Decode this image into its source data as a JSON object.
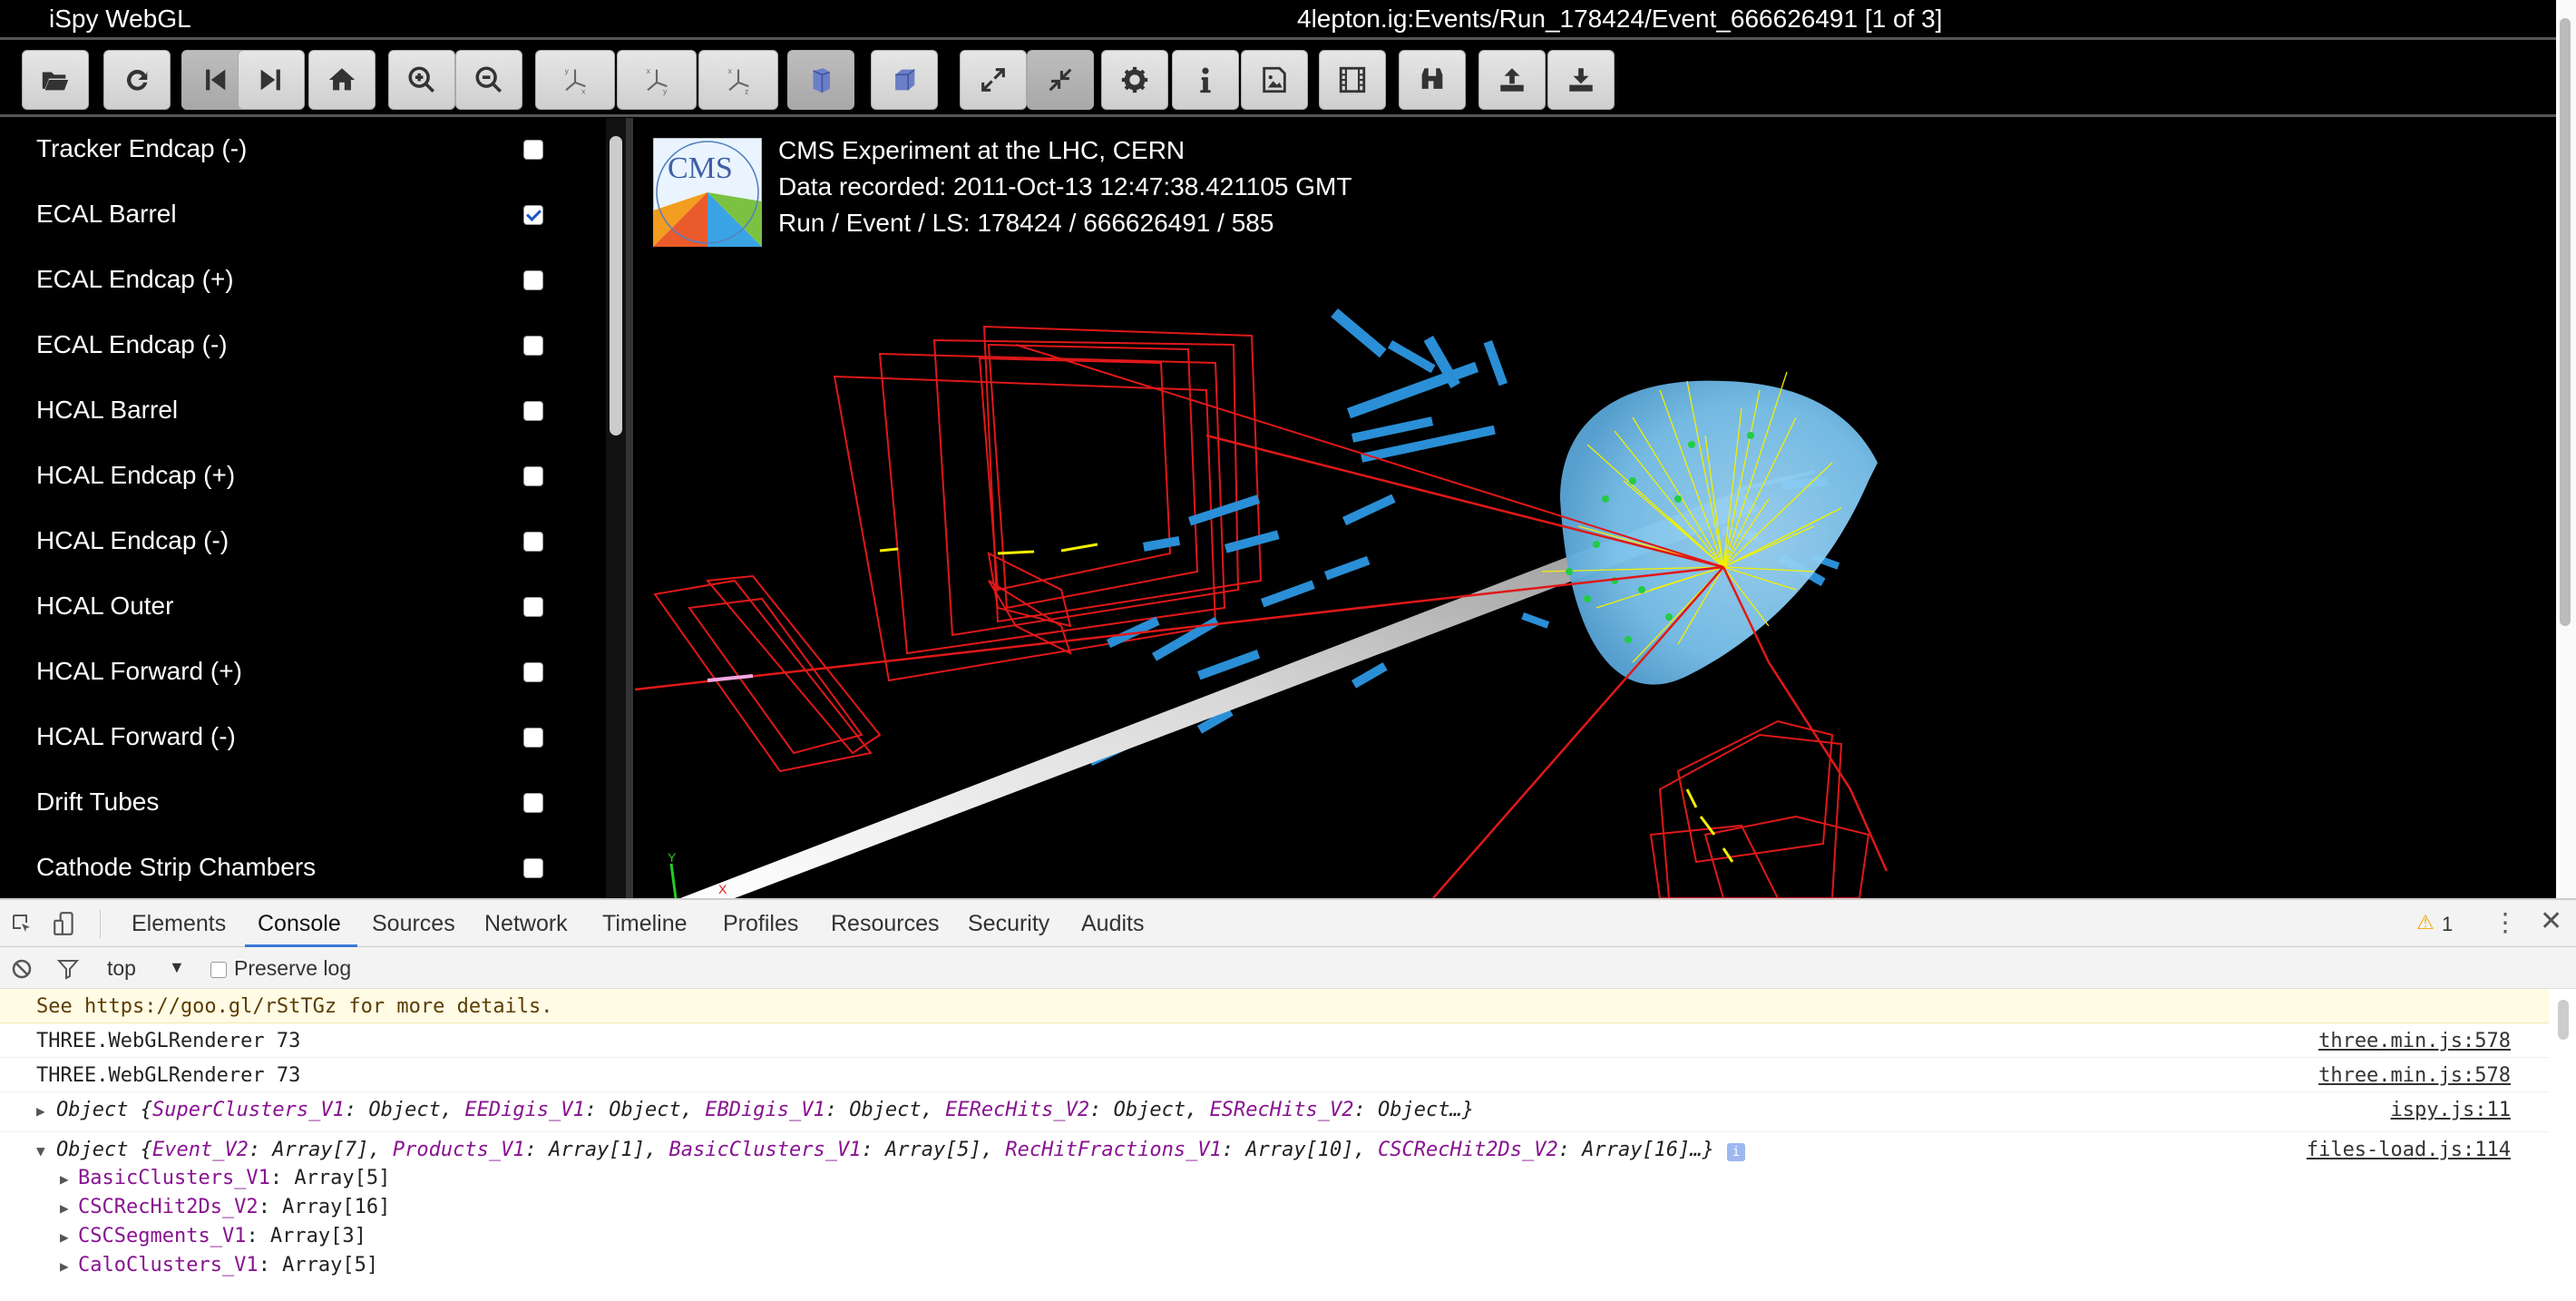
{
  "window": {
    "app_title": "iSpy WebGL",
    "event_title": "4lepton.ig:Events/Run_178424/Event_666626491 [1 of 3]"
  },
  "toolbar": {
    "buttons": [
      {
        "name": "open-icon",
        "label": "Open file"
      },
      {
        "name": "reload-icon",
        "label": "Reload"
      },
      {
        "name": "prev-event-icon",
        "label": "Previous event"
      },
      {
        "name": "next-event-icon",
        "label": "Next event"
      },
      {
        "name": "home-icon",
        "label": "Reset view"
      },
      {
        "name": "zoom-in-icon",
        "label": "Zoom in"
      },
      {
        "name": "zoom-out-icon",
        "label": "Zoom out"
      },
      {
        "name": "axes-yx-icon",
        "label": "View axes"
      },
      {
        "name": "axes-xy-icon",
        "label": "View axes"
      },
      {
        "name": "axes-zy-icon",
        "label": "View axes"
      },
      {
        "name": "perspective-icon",
        "label": "Perspective"
      },
      {
        "name": "orthographic-icon",
        "label": "Orthographic"
      },
      {
        "name": "fullscreen-icon",
        "label": "Fullscreen"
      },
      {
        "name": "shrink-icon",
        "label": "Shrink"
      },
      {
        "name": "gear-icon",
        "label": "Settings"
      },
      {
        "name": "info-icon",
        "label": "Info"
      },
      {
        "name": "image-icon",
        "label": "Picture"
      },
      {
        "name": "film-icon",
        "label": "Animate"
      },
      {
        "name": "binoculars-icon",
        "label": "Find"
      },
      {
        "name": "upload-icon",
        "label": "Upload"
      },
      {
        "name": "download-icon",
        "label": "Download"
      }
    ]
  },
  "sidebar": {
    "items": [
      {
        "label": "Tracker Endcap (-)",
        "checked": false
      },
      {
        "label": "ECAL Barrel",
        "checked": true
      },
      {
        "label": "ECAL Endcap (+)",
        "checked": false
      },
      {
        "label": "ECAL Endcap (-)",
        "checked": false
      },
      {
        "label": "HCAL Barrel",
        "checked": false
      },
      {
        "label": "HCAL Endcap (+)",
        "checked": false
      },
      {
        "label": "HCAL Endcap (-)",
        "checked": false
      },
      {
        "label": "HCAL Outer",
        "checked": false
      },
      {
        "label": "HCAL Forward (+)",
        "checked": false
      },
      {
        "label": "HCAL Forward (-)",
        "checked": false
      },
      {
        "label": "Drift Tubes",
        "checked": false
      },
      {
        "label": "Cathode Strip Chambers",
        "checked": false
      }
    ]
  },
  "viewer": {
    "logo_text": "CMS",
    "line1": "CMS Experiment at the LHC, CERN",
    "line2": "Data recorded: 2011-Oct-13 12:47:38.421105 GMT",
    "line3": "Run / Event / LS: 178424 / 666626491 / 585",
    "axis_y": "Y",
    "axis_x": "X"
  },
  "devtools": {
    "tabs": [
      "Elements",
      "Console",
      "Sources",
      "Network",
      "Timeline",
      "Profiles",
      "Resources",
      "Security",
      "Audits"
    ],
    "active_tab": "Console",
    "warning_count": "1",
    "context": "top",
    "preserve_log": "Preserve log",
    "console": {
      "warn_text": "See https://goo.gl/rStTGz for more details.",
      "log1": "THREE.WebGLRenderer 73",
      "log1_src": "three.min.js:578",
      "log2": "THREE.WebGLRenderer 73",
      "log2_src": "three.min.js:578",
      "obj1": {
        "prefix": "Object {",
        "props": [
          {
            "key": "SuperClusters_V1",
            "val": ": Object, "
          },
          {
            "key": "EEDigis_V1",
            "val": ": Object, "
          },
          {
            "key": "EBDigis_V1",
            "val": ": Object, "
          },
          {
            "key": "EERecHits_V2",
            "val": ": Object, "
          },
          {
            "key": "ESRecHits_V2",
            "val": ": Object…}"
          }
        ],
        "src": "ispy.js:11"
      },
      "obj2": {
        "prefix": "Object {",
        "props": [
          {
            "key": "Event_V2",
            "val": ": Array[7], "
          },
          {
            "key": "Products_V1",
            "val": ": Array[1], "
          },
          {
            "key": "BasicClusters_V1",
            "val": ": Array[5], "
          },
          {
            "key": "RecHitFractions_V1",
            "val": ": Array[10], "
          },
          {
            "key": "CSCRecHit2Ds_V2",
            "val": ": Array[16]…}"
          }
        ],
        "src": "files-load.js:114",
        "children": [
          {
            "key": "BasicClusters_V1",
            "val": ": Array[5]"
          },
          {
            "key": "CSCRecHit2Ds_V2",
            "val": ": Array[16]"
          },
          {
            "key": "CSCSegments_V1",
            "val": ": Array[3]"
          },
          {
            "key": "CaloClusters_V1",
            "val": ": Array[5]"
          }
        ]
      }
    }
  }
}
